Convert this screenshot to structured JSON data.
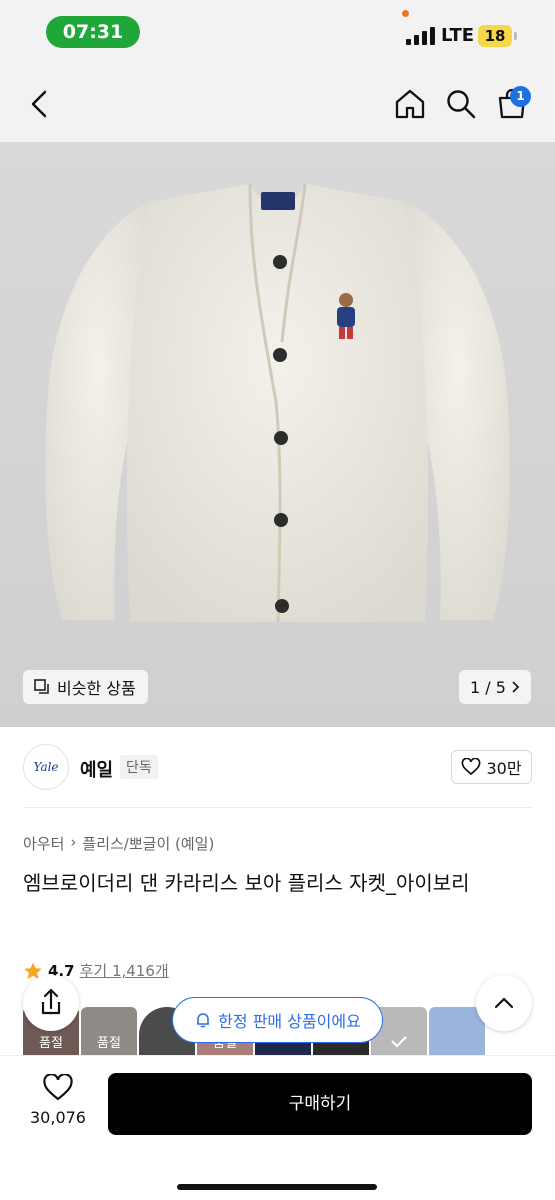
{
  "status_bar": {
    "time": "07:31",
    "network": "LTE",
    "battery": "18"
  },
  "header": {
    "cart_count": "1"
  },
  "gallery": {
    "similar_label": "비슷한 상품",
    "pager": "1 / 5"
  },
  "brand": {
    "logo_text": "Yale",
    "name": "예일",
    "tag": "단독",
    "likes": "30만"
  },
  "breadcrumb": [
    "아우터",
    "플리스/뽀글이 (예일)"
  ],
  "product": {
    "title": "엠브로이더리 댄 카라리스 보아 플리스 자켓_아이보리",
    "rating": "4.7",
    "reviews": "후기 1,416개"
  },
  "thumbnails": [
    {
      "label": "품절",
      "color": "#6f5a55"
    },
    {
      "label": "품절",
      "color": "#8e8b87"
    },
    {
      "label": "",
      "color": "#4b4b4b"
    },
    {
      "label": "품절",
      "color": "#a77f78"
    },
    {
      "label": "",
      "color": "#1f2a4a"
    },
    {
      "label": "",
      "color": "#2b2b2b"
    },
    {
      "label": "",
      "color": "#b9b9b9"
    },
    {
      "label": "",
      "color": "#9bb4dd"
    }
  ],
  "limited_notice": "한정 판매 상품이에요",
  "bottom_bar": {
    "wishlist_count": "30,076",
    "buy_label": "구매하기"
  },
  "colors": {
    "accent_blue": "#2d6ee8",
    "status_green": "#1fa73a",
    "badge_blue": "#1e6fe0"
  }
}
